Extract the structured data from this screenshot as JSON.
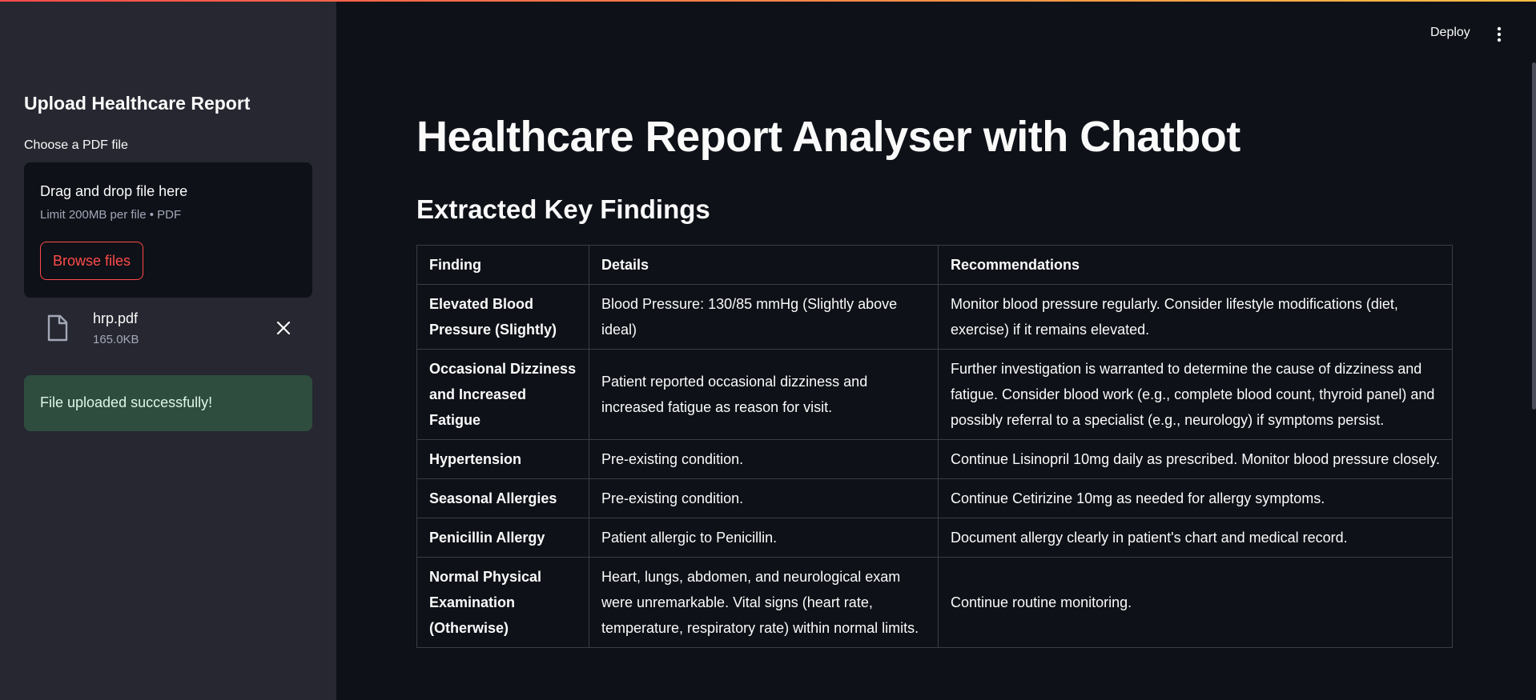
{
  "header": {
    "deploy_label": "Deploy",
    "menu_icon": "kebab-menu-icon"
  },
  "sidebar": {
    "title": "Upload Healthcare Report",
    "uploader_label": "Choose a PDF file",
    "dropzone_title": "Drag and drop file here",
    "dropzone_limit": "Limit 200MB per file • PDF",
    "browse_label": "Browse files",
    "file": {
      "name": "hrp.pdf",
      "size": "165.0KB",
      "icon": "file-icon"
    },
    "success_message": "File uploaded successfully!"
  },
  "main": {
    "title": "Healthcare Report Analyser with Chatbot",
    "section_title": "Extracted Key Findings",
    "table": {
      "headers": [
        "Finding",
        "Details",
        "Recommendations"
      ],
      "rows": [
        [
          "Elevated Blood Pressure (Slightly)",
          "Blood Pressure: 130/85 mmHg (Slightly above ideal)",
          "Monitor blood pressure regularly. Consider lifestyle modifications (diet, exercise) if it remains elevated."
        ],
        [
          "Occasional Dizziness and Increased Fatigue",
          "Patient reported occasional dizziness and increased fatigue as reason for visit.",
          "Further investigation is warranted to determine the cause of dizziness and fatigue. Consider blood work (e.g., complete blood count, thyroid panel) and possibly referral to a specialist (e.g., neurology) if symptoms persist."
        ],
        [
          "Hypertension",
          "Pre-existing condition.",
          "Continue Lisinopril 10mg daily as prescribed. Monitor blood pressure closely."
        ],
        [
          "Seasonal Allergies",
          "Pre-existing condition.",
          "Continue Cetirizine 10mg as needed for allergy symptoms."
        ],
        [
          "Penicillin Allergy",
          "Patient allergic to Penicillin.",
          "Document allergy clearly in patient's chart and medical record."
        ],
        [
          "Normal Physical Examination (Otherwise)",
          "Heart, lungs, abdomen, and neurological exam were unremarkable. Vital signs (heart rate, temperature, respiratory rate) within normal limits.",
          "Continue routine monitoring."
        ]
      ]
    }
  },
  "colors": {
    "accent": "#ff4b4b",
    "sidebar_bg": "#262730",
    "main_bg": "#0e1117",
    "success_bg": "#2e4d3e"
  }
}
